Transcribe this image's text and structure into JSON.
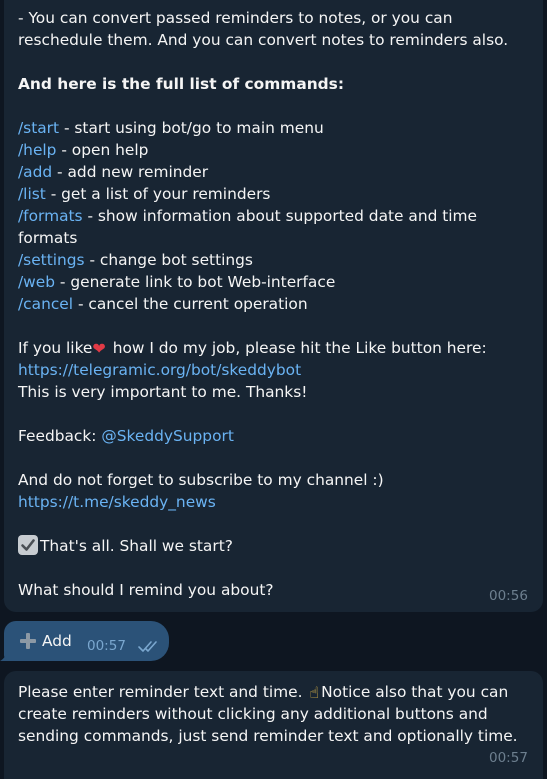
{
  "messages": {
    "first": {
      "lines": [
        "- You can convert passed reminders to notes, or you can",
        "reschedule them. And you can convert notes to reminders also.",
        "And here is the full list of commands:"
      ],
      "commands": [
        {
          "cmd": "/start",
          "desc": " - start using bot/go to main menu"
        },
        {
          "cmd": "/help",
          "desc": " - open help"
        },
        {
          "cmd": "/add",
          "desc": " - add new reminder"
        },
        {
          "cmd": "/list",
          "desc": " - get a list of your reminders"
        },
        {
          "cmd": "/formats",
          "desc": " - show information about supported date and time"
        },
        {
          "cmd": "/settings",
          "desc": " - change bot settings"
        },
        {
          "cmd": "/web",
          "desc": " - generate link to bot Web-interface"
        },
        {
          "cmd": "/cancel",
          "desc": " - cancel the current operation"
        }
      ],
      "formats_wrap": "formats",
      "like_pre": "If you like",
      "like_post": " how I do my job, please hit the Like button here:",
      "like_link": "https://telegramic.org/bot/skeddybot",
      "important": "This is very important to me. Thanks!",
      "feedback_label": "Feedback: ",
      "feedback_link": "@SkeddySupport",
      "subscribe": "And do not forget to subscribe to my channel :)",
      "channel_link": "https://t.me/skeddy_news",
      "thats_all": "That's all. Shall we start?",
      "question": "What should I remind you about?",
      "time": "00:56"
    },
    "outgoing": {
      "label": "Add",
      "time": "00:57",
      "icon": "plus-icon",
      "status_icon": "double-check-icon"
    },
    "third": {
      "line1_pre": "Please enter reminder text and time. ",
      "line1_post": "Notice also that you can",
      "line2": "create reminders without clicking any additional buttons and",
      "line3": "sending commands, just send reminder text and optionally time.",
      "time": "00:57"
    }
  },
  "colors": {
    "background": "#0e1621",
    "incoming_bubble": "#182533",
    "outgoing_bubble": "#2b5278",
    "link": "#6ab3f3",
    "text": "#f5f5f5",
    "time": "#6d7f8f"
  }
}
